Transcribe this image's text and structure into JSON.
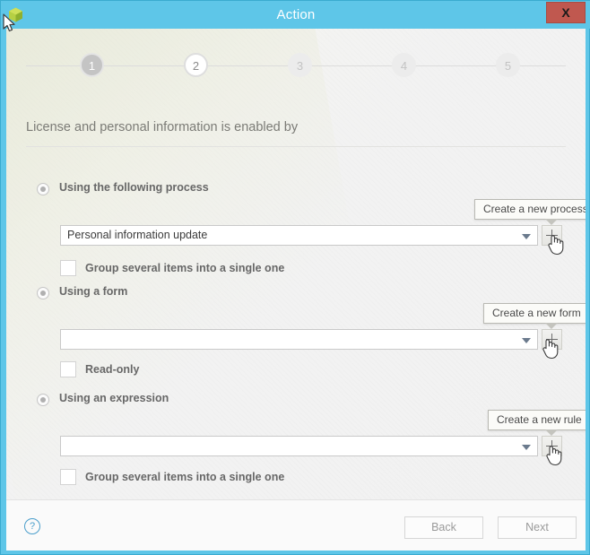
{
  "window": {
    "title": "Action",
    "app_icon": "cube-icon",
    "close_label": "X"
  },
  "stepper": {
    "steps": [
      {
        "label": "1",
        "state": "done"
      },
      {
        "label": "2",
        "state": "current"
      },
      {
        "label": "3",
        "state": "todo"
      },
      {
        "label": "4",
        "state": "todo"
      },
      {
        "label": "5",
        "state": "todo"
      }
    ]
  },
  "section": {
    "title": "License and personal information is enabled by"
  },
  "options": {
    "process": {
      "radio_label": "Using the following process",
      "tooltip": "Create a new process",
      "combo_value": "Personal information update",
      "combo_placeholder": "",
      "add_button_label": "+",
      "checkbox_label": "Group several items into a single one",
      "checked": false,
      "selected": true
    },
    "form": {
      "radio_label": "Using a form",
      "tooltip": "Create a new form",
      "combo_value": "",
      "combo_placeholder": "",
      "add_button_label": "+",
      "checkbox_label": "Read-only",
      "checked": false,
      "selected": true
    },
    "expression": {
      "radio_label": "Using an expression",
      "tooltip": "Create a new rule",
      "combo_value": "",
      "combo_placeholder": "",
      "add_button_label": "+",
      "checkbox_label": "Group several items into a single one",
      "checked": false,
      "selected": true
    }
  },
  "footer": {
    "help_label": "?",
    "back_label": "Back",
    "next_label": "Next"
  },
  "colors": {
    "titlebar": "#5ec6e8",
    "close_button": "#c0584f",
    "help_accent": "#4a9ecb",
    "panel": "#f2f2f0"
  }
}
